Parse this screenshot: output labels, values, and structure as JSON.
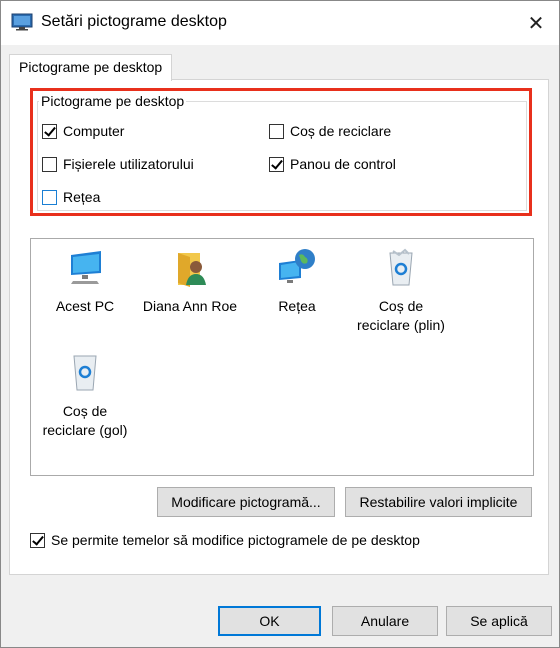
{
  "window": {
    "title": "Setări pictograme desktop",
    "close_glyph": "✕"
  },
  "tab": {
    "label": "Pictograme pe desktop"
  },
  "group": {
    "title": "Pictograme pe desktop",
    "items": [
      {
        "label": "Computer",
        "checked": true
      },
      {
        "label": "Coș de reciclare",
        "checked": false
      },
      {
        "label": "Fișierele utilizatorului",
        "checked": false
      },
      {
        "label": "Panou de control",
        "checked": true
      },
      {
        "label": "Rețea",
        "checked": false
      }
    ]
  },
  "preview": {
    "icons": [
      {
        "label": "Acest PC",
        "icon": "monitor-icon"
      },
      {
        "label": "Diana Ann Roe",
        "icon": "user-folder-icon"
      },
      {
        "label": "Rețea",
        "icon": "network-globe-icon"
      },
      {
        "label": "Coș de\nreciclare (plin)",
        "icon": "recycle-bin-full-icon"
      },
      {
        "label": "Coș de\nreciclare (gol)",
        "icon": "recycle-bin-empty-icon"
      }
    ]
  },
  "buttons": {
    "change_icon": "Modificare pictogramă...",
    "restore_default": "Restabilire valori implicite",
    "ok": "OK",
    "cancel": "Anulare",
    "apply": "Se aplică"
  },
  "themes_option": {
    "label": "Se permite temelor să modifice pictogramele de pe desktop",
    "checked": true
  },
  "colors": {
    "highlight": "#e8301c",
    "focus_blue": "#0078d7"
  }
}
